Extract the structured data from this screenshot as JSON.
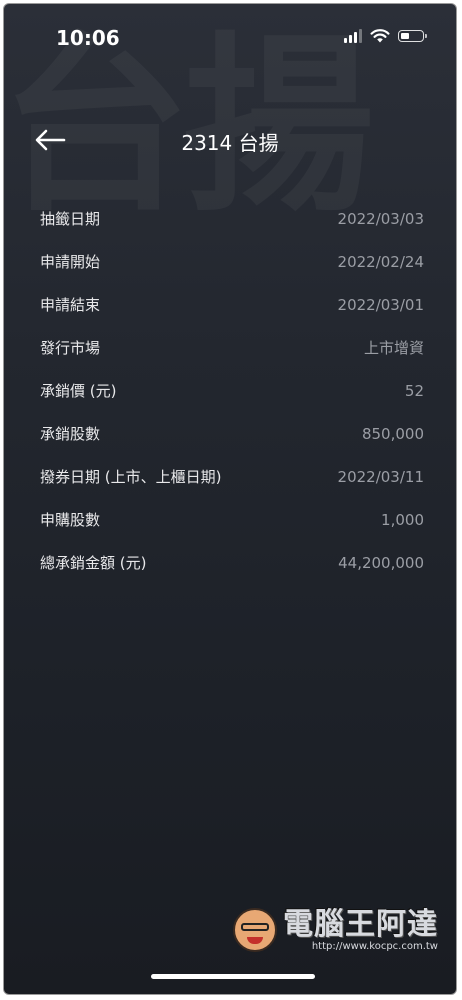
{
  "status_bar": {
    "time": "10:06",
    "icons": [
      "cellular-signal-icon",
      "wifi-icon",
      "battery-icon"
    ]
  },
  "background_watermark": "台揚",
  "header": {
    "back_icon": "arrow-left-icon",
    "title": "2314 台揚"
  },
  "details": [
    {
      "label": "抽籤日期",
      "value": "2022/03/03"
    },
    {
      "label": "申請開始",
      "value": "2022/02/24"
    },
    {
      "label": "申請結束",
      "value": "2022/03/01"
    },
    {
      "label": "發行市場",
      "value": "上市增資"
    },
    {
      "label": "承銷價 (元)",
      "value": "52"
    },
    {
      "label": "承銷股數",
      "value": "850,000"
    },
    {
      "label": "撥券日期 (上市、上櫃日期)",
      "value": "2022/03/11"
    },
    {
      "label": "申購股數",
      "value": "1,000"
    },
    {
      "label": "總承銷金額 (元)",
      "value": "44,200,000"
    }
  ],
  "watermark_logo": {
    "name": "電腦王阿達",
    "url": "http://www.kocpc.com.tw"
  },
  "colors": {
    "background_top": "#2b2f38",
    "background_bottom": "#191c22",
    "label": "#e8e8ea",
    "value": "#9b9ea5"
  }
}
